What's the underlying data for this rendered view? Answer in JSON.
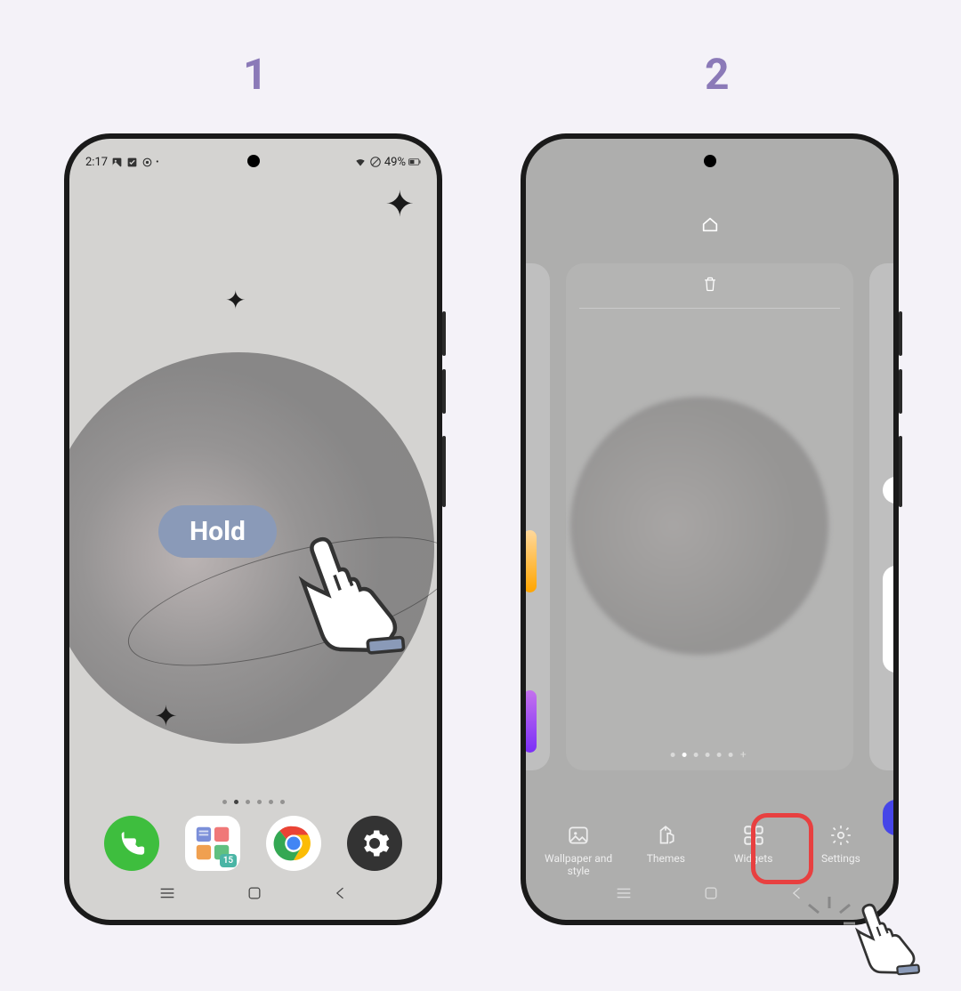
{
  "steps": {
    "one": "1",
    "two": "2"
  },
  "status_bar": {
    "time": "2:17",
    "battery": "49%"
  },
  "hold_label": "Hold",
  "apps_badge": "15",
  "options": {
    "wallpaper": "Wallpaper and style",
    "themes": "Themes",
    "widgets": "Widgets",
    "settings": "Settings"
  }
}
